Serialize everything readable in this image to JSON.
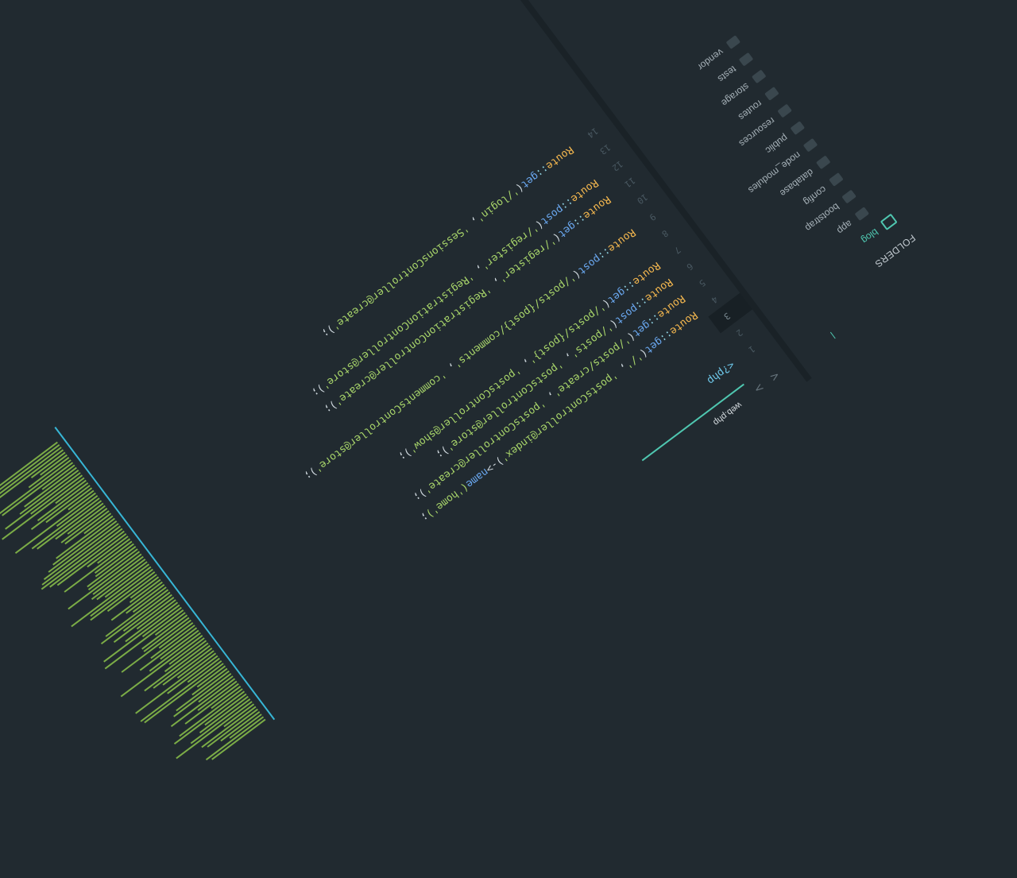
{
  "sidebar": {
    "title": "FOLDERS",
    "root": "blog",
    "folders": [
      "app",
      "bootstrap",
      "config",
      "database",
      "node_modules",
      "public",
      "resources",
      "routes",
      "storage",
      "tests",
      "vendor"
    ]
  },
  "editor": {
    "tab": {
      "label": "web.php"
    },
    "line_numbers": [
      "1",
      "2",
      "3",
      "4",
      "5",
      "6",
      "7",
      "8",
      "9",
      "10",
      "11",
      "12",
      "13",
      "14"
    ],
    "active_line": 3,
    "code": {
      "line1": {
        "tag": "<?php"
      },
      "line4": {
        "cls": "Route",
        "op": "::",
        "fn": "get",
        "open": "(",
        "a": "'/'",
        "sep": ", ",
        "b": "'postsController@index'",
        "close": ")->",
        "fn2": "name",
        "arg": "('home')",
        "end": ";"
      },
      "line5": {
        "cls": "Route",
        "op": "::",
        "fn": "get",
        "open": "(",
        "a": "'/posts/create'",
        "sep": ", ",
        "b": "'postsController@create'",
        "end": ");"
      },
      "line6": {
        "cls": "Route",
        "op": "::",
        "fn": "post",
        "open": "(",
        "a": "'/posts'",
        "sep": ", ",
        "b": "'postsController@store'",
        "end": ");"
      },
      "line7": {
        "cls": "Route",
        "op": "::",
        "fn": "get",
        "open": "(",
        "a": "'/posts/{post}'",
        "sep": ", ",
        "b": "'postsController@show'",
        "end": ");"
      },
      "line9": {
        "cls": "Route",
        "op": "::",
        "fn": "post",
        "open": "(",
        "a": "'/posts/{post}/comments'",
        "sep": ", ",
        "b": "'commentsController@store'",
        "end": ");"
      },
      "line11": {
        "cls": "Route",
        "op": "::",
        "fn": "get",
        "open": "(",
        "a": "'/register'",
        "sep": ", ",
        "b": "'RegistrationController@create'",
        "end": ");"
      },
      "line12": {
        "cls": "Route",
        "op": "::",
        "fn": "post",
        "open": "(",
        "a": "'/register'",
        "sep": ", ",
        "b": "'RegistrationController@store'",
        "end": ");"
      },
      "line14": {
        "cls": "Route",
        "op": "::",
        "fn": "get",
        "open": "(",
        "a": "'/login'",
        "sep": ", ",
        "b": "'SessionsController@create'",
        "end": ");"
      }
    }
  },
  "colors": {
    "background": "#212a30",
    "accent": "#4fc7b0",
    "class": "#f5b84f",
    "function": "#6aa8f0",
    "string": "#a8d56a"
  }
}
